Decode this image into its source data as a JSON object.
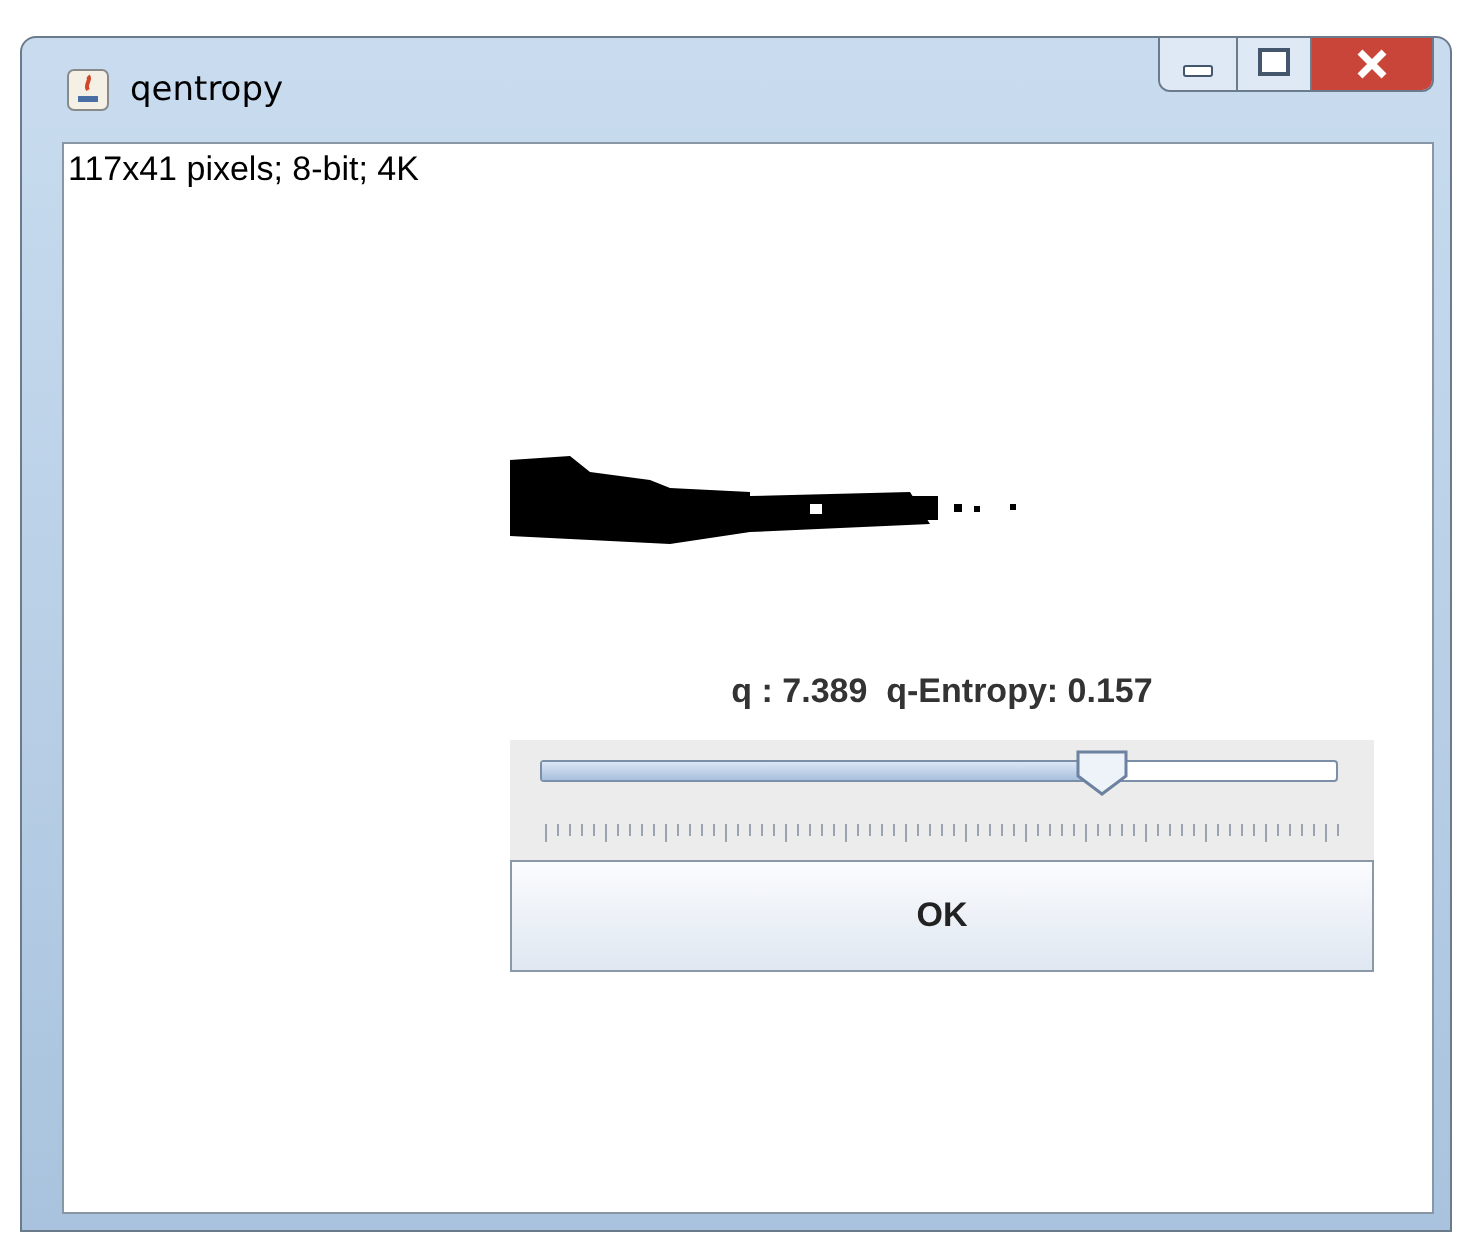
{
  "window": {
    "title": "qentropy"
  },
  "image_info": "117x41 pixels; 8-bit; 4K",
  "readout": "q : 7.389  q-Entropy: 0.157",
  "slider": {
    "level": 0.706
  },
  "buttons": [
    "OK"
  ]
}
